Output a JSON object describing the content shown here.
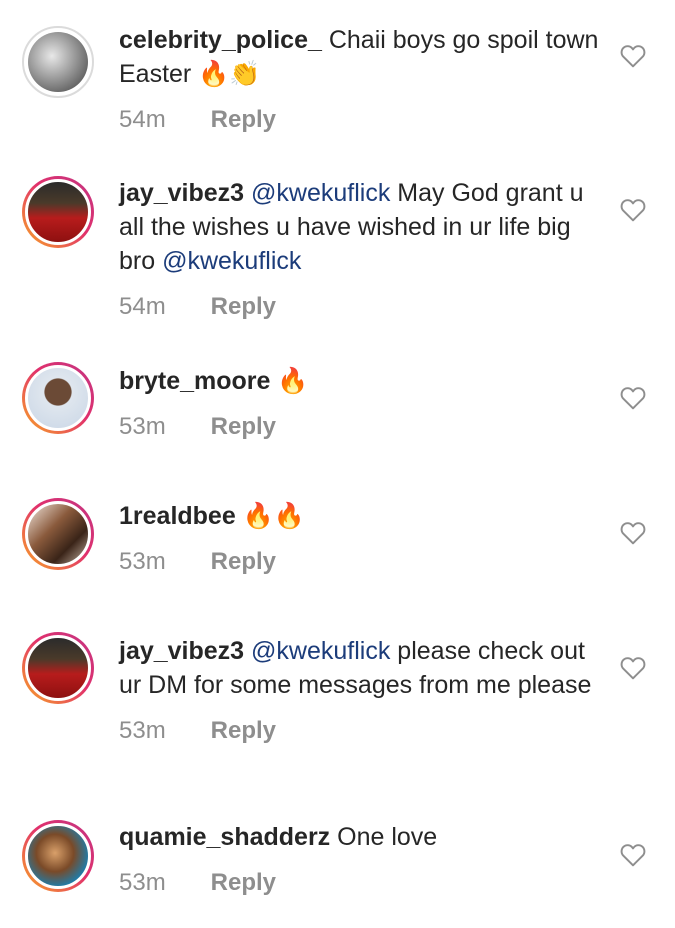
{
  "comments": [
    {
      "username": "celebrity_police_",
      "text_parts": [
        "Chaii boys go spoil town Easter",
        "🔥",
        "👏"
      ],
      "time": "54m",
      "reply_label": "Reply",
      "avatar_icon": "profile-photo-grayscale"
    },
    {
      "username": "jay_vibez3",
      "mention1": "@kwekuflick",
      "text": "May God grant u all the wishes u have wished in ur life big bro",
      "mention2": "@kwekuflick",
      "time": "54m",
      "reply_label": "Reply",
      "avatar_icon": "profile-photo-red-jersey"
    },
    {
      "username": "bryte_moore",
      "emoji": "🔥",
      "time": "53m",
      "reply_label": "Reply",
      "avatar_icon": "profile-photo-child"
    },
    {
      "username": "1realdbee",
      "emoji": "🔥🔥",
      "time": "53m",
      "reply_label": "Reply",
      "avatar_icon": "profile-photo-couple"
    },
    {
      "username": "jay_vibez3",
      "mention1": "@kwekuflick",
      "text": "please check out ur  DM for some messages from me please",
      "time": "53m",
      "reply_label": "Reply",
      "avatar_icon": "profile-photo-red-jersey"
    },
    {
      "username": "quamie_shadderz",
      "text": "One love",
      "time": "53m",
      "reply_label": "Reply",
      "avatar_icon": "profile-photo-portrait"
    }
  ],
  "colors": {
    "username": "#262626",
    "mention": "#1c3c7a",
    "meta": "#8e8e8e",
    "heart": "#8e8e8e"
  }
}
